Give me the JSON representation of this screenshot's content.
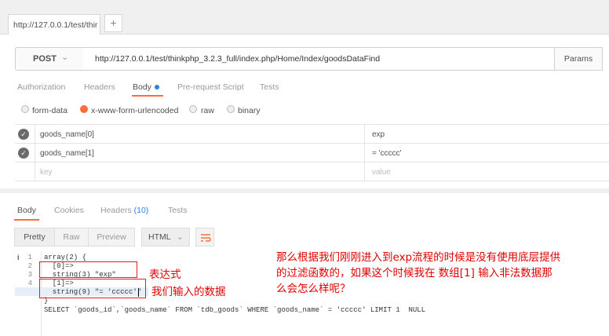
{
  "tab": {
    "title": "http://127.0.0.1/test/thir",
    "add_label": "+"
  },
  "request": {
    "method": "POST",
    "url": "http://127.0.0.1/test/thinkphp_3.2.3_full/index.php/Home/Index/goodsDataFind",
    "params_label": "Params"
  },
  "subtabs": [
    "Authorization",
    "Headers",
    "Body",
    "Pre-request Script",
    "Tests"
  ],
  "body_types": [
    "form-data",
    "x-www-form-urlencoded",
    "raw",
    "binary"
  ],
  "form_rows": [
    {
      "key": "goods_name[0]",
      "value": "exp"
    },
    {
      "key": "goods_name[1]",
      "value": "= 'ccccc'"
    }
  ],
  "placeholders": {
    "key": "key",
    "value": "value"
  },
  "response_tabs": {
    "body": "Body",
    "cookies": "Cookies",
    "headers": "Headers",
    "headers_count": "(10)",
    "tests": "Tests"
  },
  "view_buttons": [
    "Pretty",
    "Raw",
    "Preview"
  ],
  "format": "HTML",
  "code_lines": [
    {
      "num": "1",
      "text": "array(2) {"
    },
    {
      "num": "2",
      "text": "  [0]=>"
    },
    {
      "num": "3",
      "text": "  string(3) \"exp\""
    },
    {
      "num": "4",
      "text": "  [1]=>"
    },
    {
      "num": "5",
      "text": "  string(9) \"= 'ccccc'\""
    },
    {
      "num": "",
      "text": "}"
    },
    {
      "num": "",
      "text": "SELECT `goods_id`,`goods_name` FROM `tdb_goods` WHERE `goods_name` = 'ccccc' LIMIT 1  NULL"
    }
  ],
  "annotations": {
    "expression": "表达式",
    "input_data": "我们输入的数据",
    "note_line1": "那么根据我们刚刚进入到exp流程的时候是没有使用底层提供",
    "note_line2": "的过滤函数的，如果这个时候我在 数组[1] 输入非法数据那",
    "note_line3": "么会怎么样呢？"
  },
  "colors": {
    "accent": "#ff6c37",
    "annotation": "#e00000",
    "dot": "#2f80ed"
  }
}
